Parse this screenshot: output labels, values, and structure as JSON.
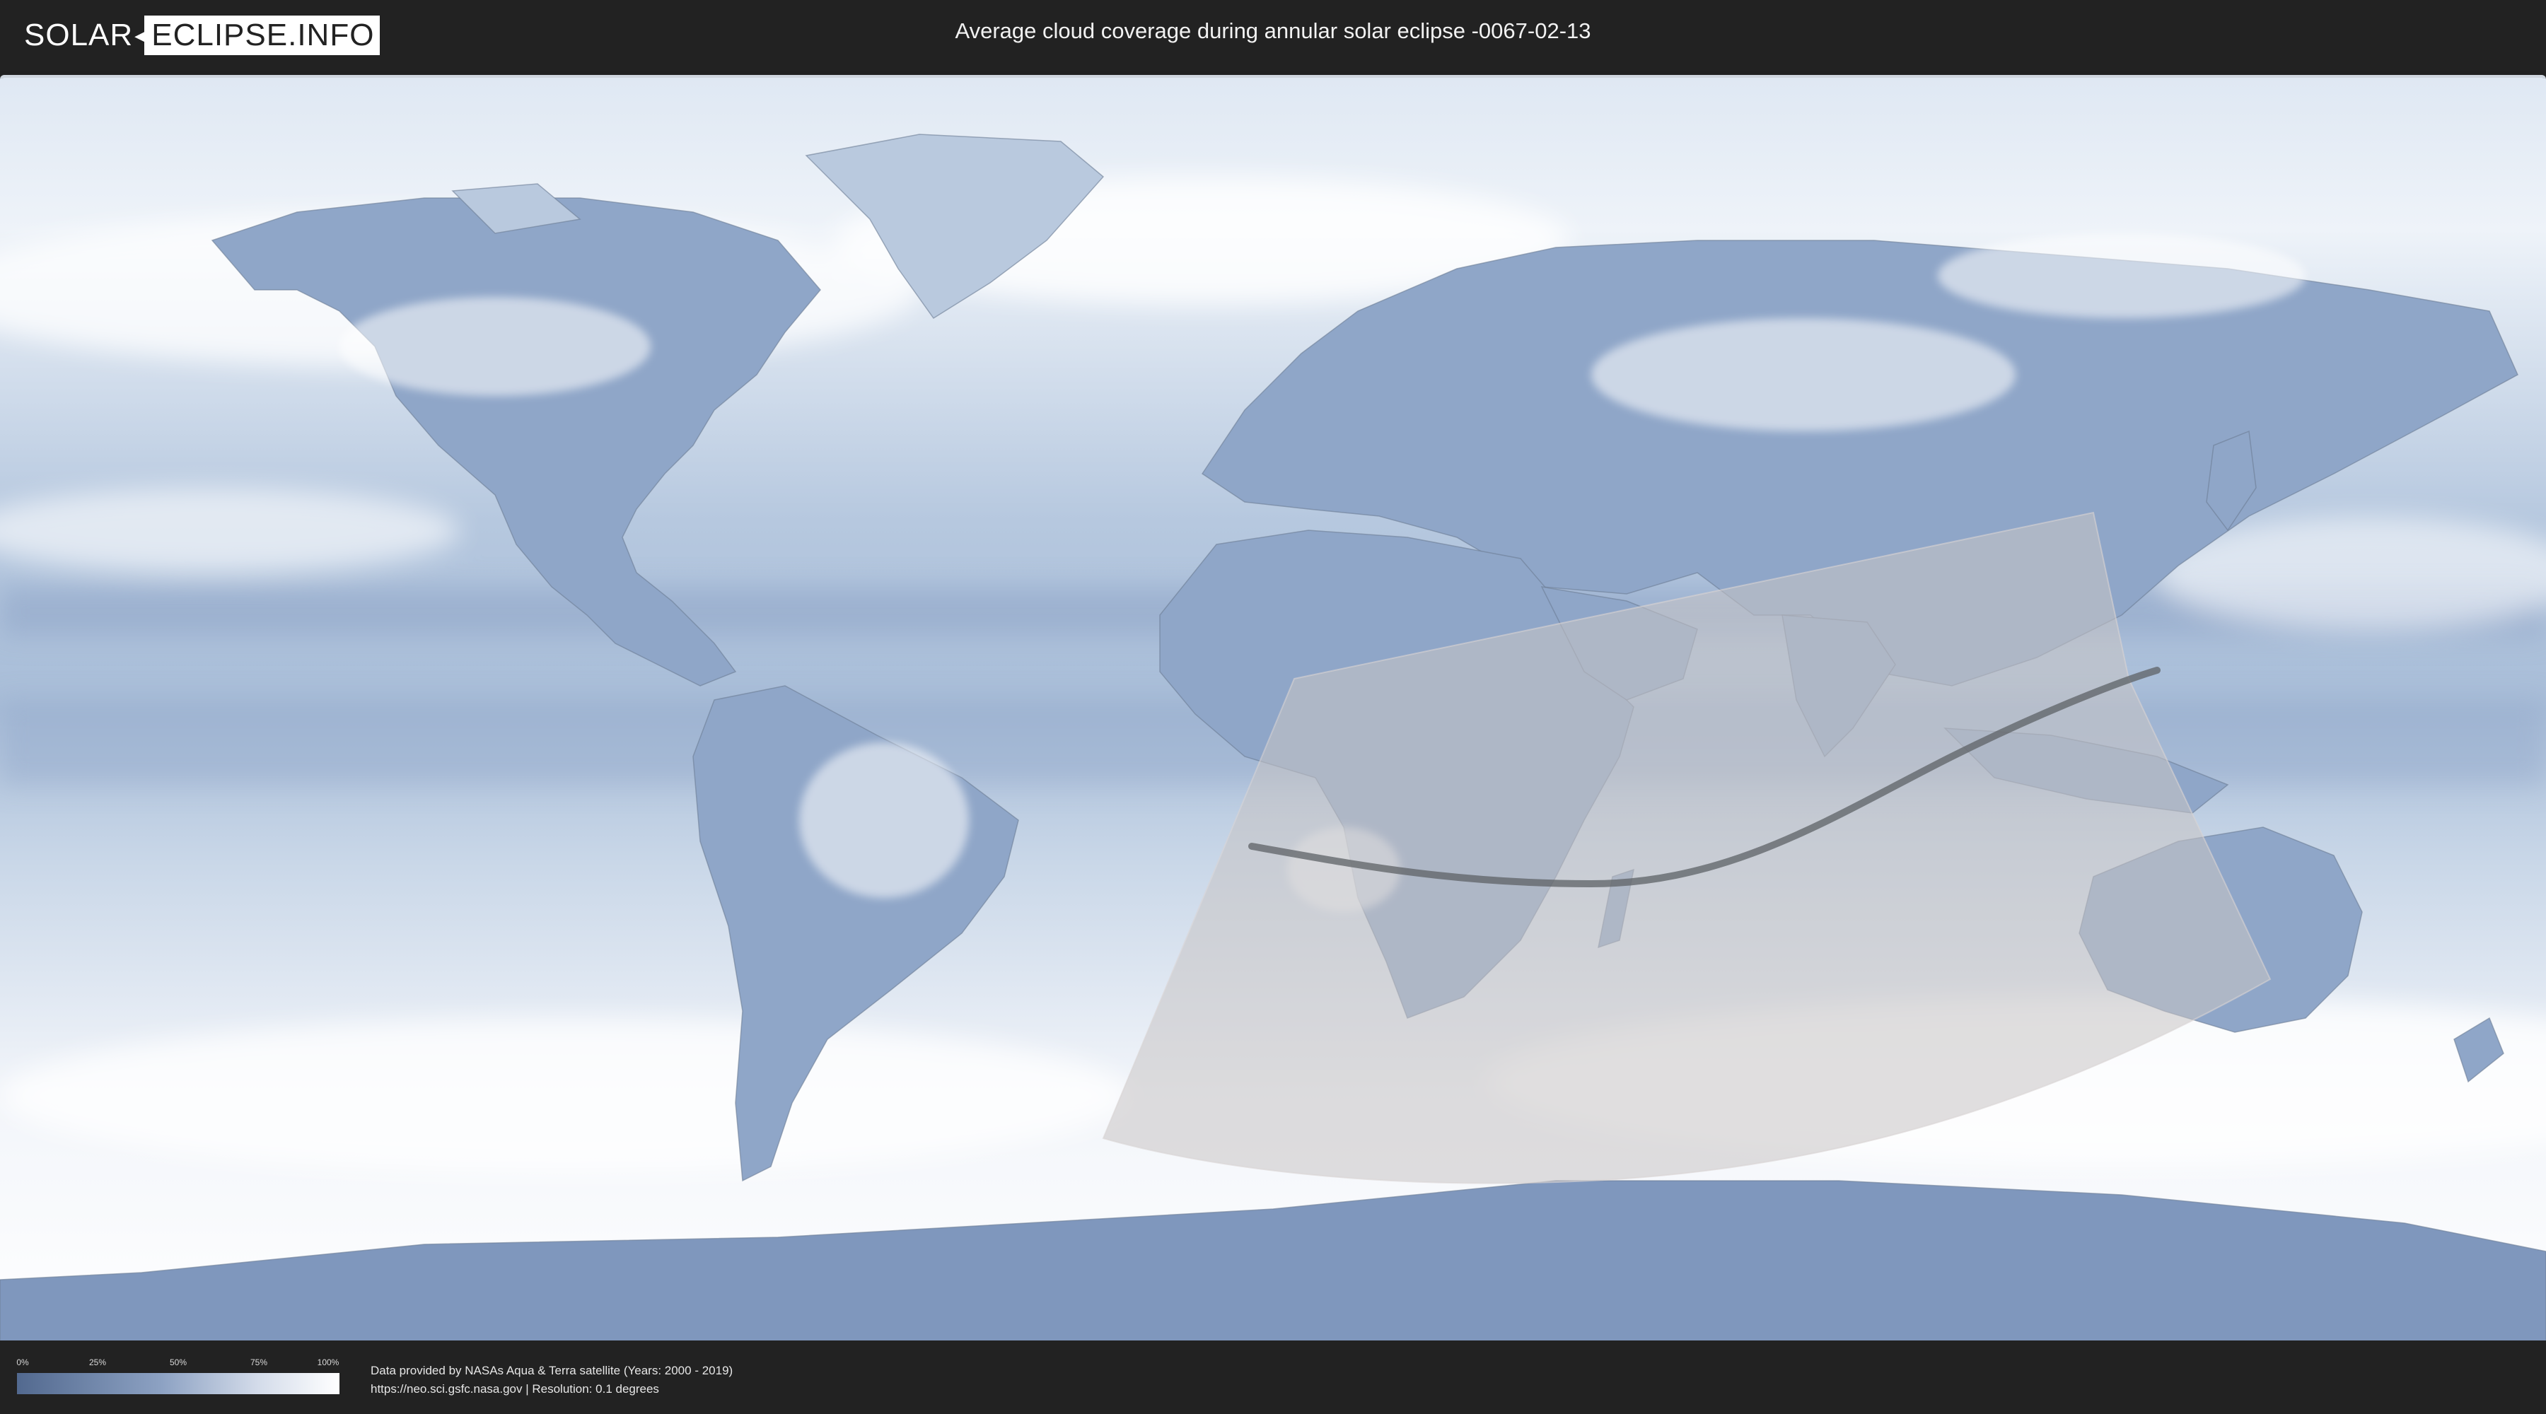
{
  "header": {
    "logo_left": "SOLAR",
    "logo_right": "ECLIPSE.INFO",
    "title": "Average cloud coverage during annular solar eclipse -0067-02-13"
  },
  "map": {
    "projection": "equirectangular world map",
    "base_colors": {
      "clear": "#52698f",
      "mid": "#9fb3cf",
      "cloudy": "#ffffff"
    },
    "visibility_zone_color": "#c9c4c4",
    "eclipse_path_color": "#5d6166"
  },
  "legend": {
    "ticks": [
      "0%",
      "25%",
      "50%",
      "75%",
      "100%"
    ]
  },
  "credits": {
    "line1": "Data provided by NASAs Aqua & Terra satellite (Years: 2000 - 2019)",
    "line2": "https://neo.sci.gsfc.nasa.gov | Resolution: 0.1 degrees"
  }
}
